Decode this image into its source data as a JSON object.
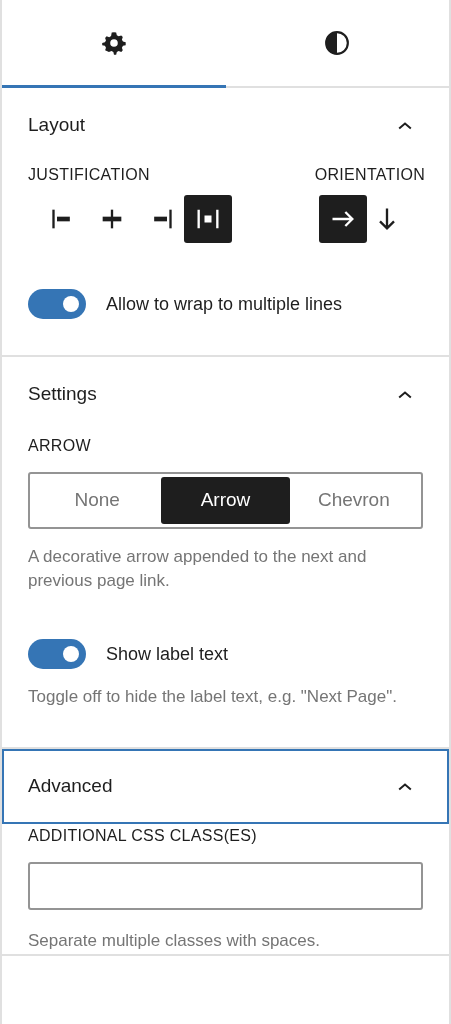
{
  "tabs": [
    {
      "kind": "settings",
      "selected": true
    },
    {
      "kind": "styles",
      "selected": false
    }
  ],
  "layout": {
    "title": "Layout",
    "expanded": true,
    "focused": false,
    "justification": {
      "label": "JUSTIFICATION",
      "options": [
        {
          "kind": "left",
          "selected": false
        },
        {
          "kind": "center",
          "selected": false
        },
        {
          "kind": "right",
          "selected": false
        },
        {
          "kind": "space-between",
          "selected": true
        }
      ]
    },
    "orientation": {
      "label": "ORIENTATION",
      "options": [
        {
          "kind": "horizontal",
          "selected": true
        },
        {
          "kind": "vertical",
          "selected": false
        }
      ]
    },
    "wrap_toggle": {
      "label": "Allow to wrap to multiple lines",
      "on": true
    }
  },
  "settings": {
    "title": "Settings",
    "expanded": true,
    "focused": false,
    "arrow": {
      "label": "ARROW",
      "options": [
        {
          "label": "None",
          "selected": false
        },
        {
          "label": "Arrow",
          "selected": true
        },
        {
          "label": "Chevron",
          "selected": false
        }
      ],
      "help": "A decorative arrow appended to the next and previous page link."
    },
    "label_toggle": {
      "label": "Show label text",
      "on": true,
      "help": "Toggle off to hide the label text, e.g. \"Next Page\"."
    }
  },
  "advanced": {
    "title": "Advanced",
    "expanded": true,
    "focused": true,
    "css_class": {
      "label": "ADDITIONAL CSS CLASS(ES)",
      "help": "Separate multiple classes with spaces."
    }
  }
}
